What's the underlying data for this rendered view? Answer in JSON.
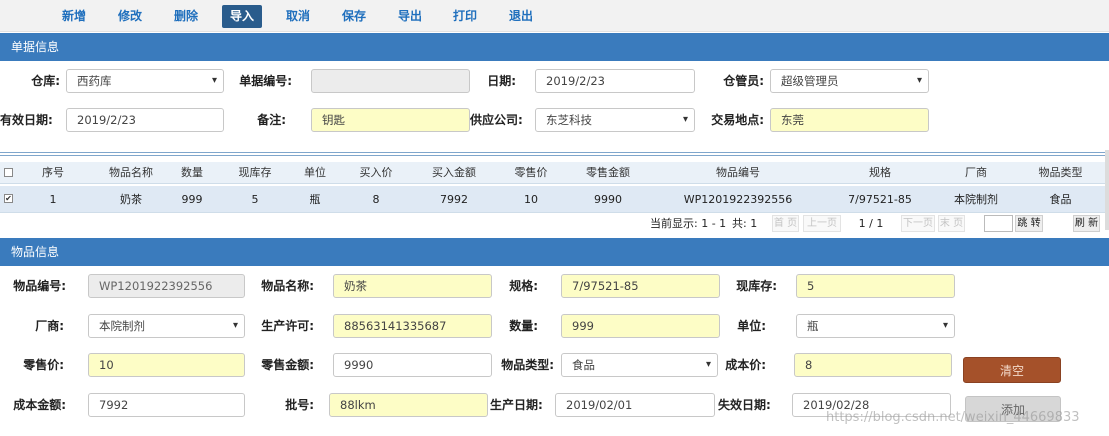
{
  "toolbar": {
    "buttons": [
      "新增",
      "修改",
      "删除",
      "导入",
      "取消",
      "保存",
      "导出",
      "打印",
      "退出"
    ],
    "active": "导入"
  },
  "doc_section": {
    "title": "单据信息",
    "warehouse_label": "仓库:",
    "warehouse_value": "西药库",
    "doc_no_label": "单据编号:",
    "doc_no_value": "",
    "date_label": "日期:",
    "date_value": "2019/2/23",
    "keeper_label": "仓管员:",
    "keeper_value": "超级管理员",
    "valid_date_label": "有效日期:",
    "valid_date_value": "2019/2/23",
    "remark_label": "备注:",
    "remark_value": "钥匙",
    "supplier_label": "供应公司:",
    "supplier_value": "东芝科技",
    "place_label": "交易地点:",
    "place_value": "东莞"
  },
  "grid": {
    "headers": [
      "序号",
      "物品名称",
      "数量",
      "现库存",
      "单位",
      "买入价",
      "买入金额",
      "零售价",
      "零售金额",
      "物品编号",
      "规格",
      "厂商",
      "物品类型"
    ],
    "rows": [
      [
        "1",
        "奶茶",
        "999",
        "5",
        "瓶",
        "8",
        "7992",
        "10",
        "9990",
        "WP1201922392556",
        "7/97521-85",
        "本院制剂",
        "食品"
      ]
    ],
    "row_checked": true
  },
  "pager": {
    "current_display": "当前显示: 1 - 1",
    "total": "共: 1",
    "first": "首 页",
    "prev": "上一页",
    "page": "1 / 1",
    "next": "下一页",
    "last": "末 页",
    "goto": "跳 转",
    "refresh": "刷 新"
  },
  "item_section": {
    "title": "物品信息",
    "code_label": "物品编号:",
    "code_value": "WP1201922392556",
    "name_label": "物品名称:",
    "name_value": "奶茶",
    "spec_label": "规格:",
    "spec_value": "7/97521-85",
    "stock_label": "现库存:",
    "stock_value": "5",
    "maker_label": "厂商:",
    "maker_value": "本院制剂",
    "license_label": "生产许可:",
    "license_value": "88563141335687",
    "qty_label": "数量:",
    "qty_value": "999",
    "unit_label": "单位:",
    "unit_value": "瓶",
    "retail_label": "零售价:",
    "retail_value": "10",
    "retail_amt_label": "零售金额:",
    "retail_amt_value": "9990",
    "type_label": "物品类型:",
    "type_value": "食品",
    "cost_label": "成本价:",
    "cost_value": "8",
    "clear_btn": "清空",
    "cost_amt_label": "成本金额:",
    "cost_amt_value": "7992",
    "batch_label": "批号:",
    "batch_value": "88lkm",
    "mfg_date_label": "生产日期:",
    "mfg_date_value": "2019/02/01",
    "exp_date_label": "失效日期:",
    "exp_date_value": "2019/02/28",
    "add_btn": "添加"
  },
  "watermark": "https://blog.csdn.net/weixin_44669833"
}
